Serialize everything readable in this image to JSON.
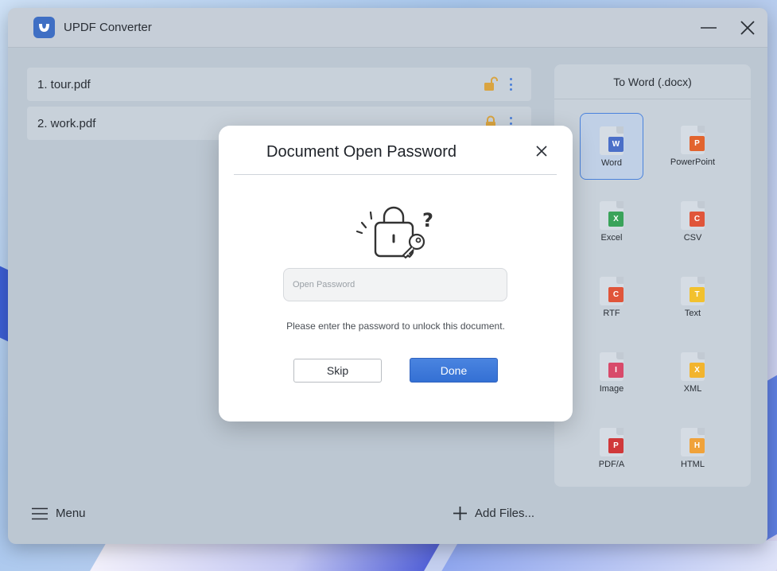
{
  "window": {
    "title": "UPDF Converter"
  },
  "files": [
    {
      "label": "1.  tour.pdf",
      "lock": "unlocked"
    },
    {
      "label": "2.  work.pdf",
      "lock": "locked"
    }
  ],
  "side_panel": {
    "header": "To Word (.docx)",
    "formats": [
      {
        "label": "Word",
        "badge": "W",
        "color": "#4b6fc8",
        "selected": true
      },
      {
        "label": "PowerPoint",
        "badge": "P",
        "color": "#e2642e",
        "selected": false
      },
      {
        "label": "Excel",
        "badge": "X",
        "color": "#3aa35a",
        "selected": false
      },
      {
        "label": "CSV",
        "badge": "C",
        "color": "#e0553a",
        "selected": false
      },
      {
        "label": "RTF",
        "badge": "C",
        "color": "#e0553a",
        "selected": false
      },
      {
        "label": "Text",
        "badge": "T",
        "color": "#f2c12e",
        "selected": false
      },
      {
        "label": "Image",
        "badge": "I",
        "color": "#d84a6a",
        "selected": false
      },
      {
        "label": "XML",
        "badge": "X",
        "color": "#f2b42e",
        "selected": false
      },
      {
        "label": "PDF/A",
        "badge": "P",
        "color": "#d0383a",
        "selected": false
      },
      {
        "label": "HTML",
        "badge": "H",
        "color": "#f0a23a",
        "selected": false
      }
    ]
  },
  "bottom": {
    "menu_label": "Menu",
    "add_files_label": "Add Files..."
  },
  "dialog": {
    "title": "Document Open Password",
    "input_placeholder": "Open Password",
    "input_value": "",
    "hint": "Please enter the password to unlock this document.",
    "skip_label": "Skip",
    "done_label": "Done"
  },
  "colors": {
    "accent": "#3a74d8",
    "lock_icon": "#d9a441"
  }
}
